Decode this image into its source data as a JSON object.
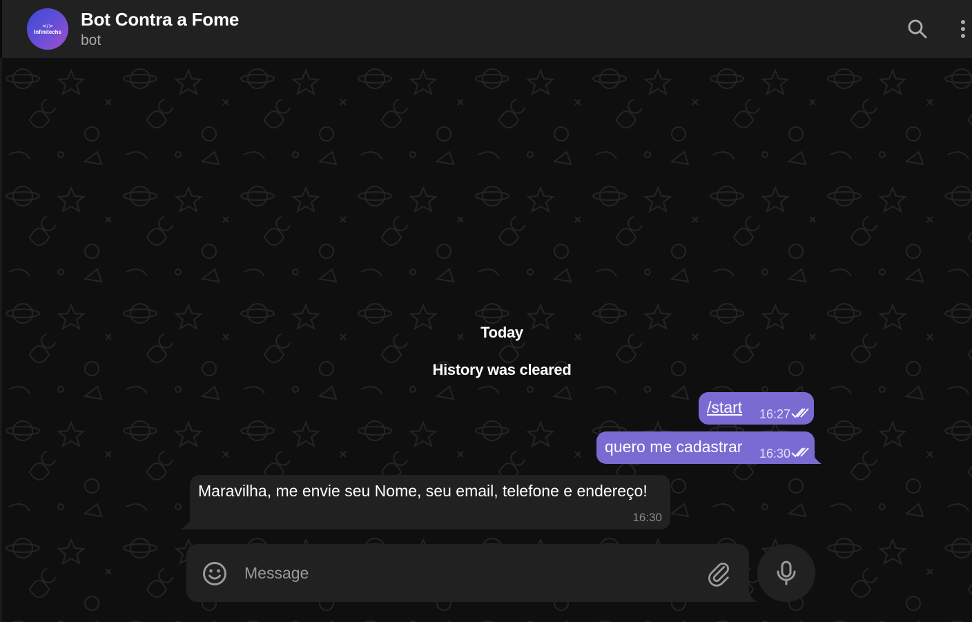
{
  "header": {
    "avatar_code": "</>",
    "avatar_brand": "Infinitechs",
    "title": "Bot Contra a Fome",
    "subtitle": "bot",
    "icons": [
      "search-icon",
      "more-vertical-icon"
    ]
  },
  "chat": {
    "date_label": "Today",
    "service_message": "History was cleared",
    "messages": [
      {
        "direction": "out",
        "text": "/start",
        "time": "16:27",
        "status": "read"
      },
      {
        "direction": "out",
        "text": "quero me cadastrar",
        "time": "16:30",
        "status": "read"
      },
      {
        "direction": "in",
        "text": "Maravilha, me envie seu Nome, seu email, telefone e endereço!",
        "time": "16:30"
      }
    ]
  },
  "composer": {
    "placeholder": "Message",
    "value": "",
    "icons": [
      "emoji-icon",
      "paperclip-icon",
      "microphone-icon"
    ]
  },
  "colors": {
    "header_bg": "#212121",
    "chat_bg": "#0f0f0f",
    "outgoing_bubble": "#7a6bd3",
    "incoming_bubble": "#212121",
    "subtitle": "#a8a8a8"
  }
}
